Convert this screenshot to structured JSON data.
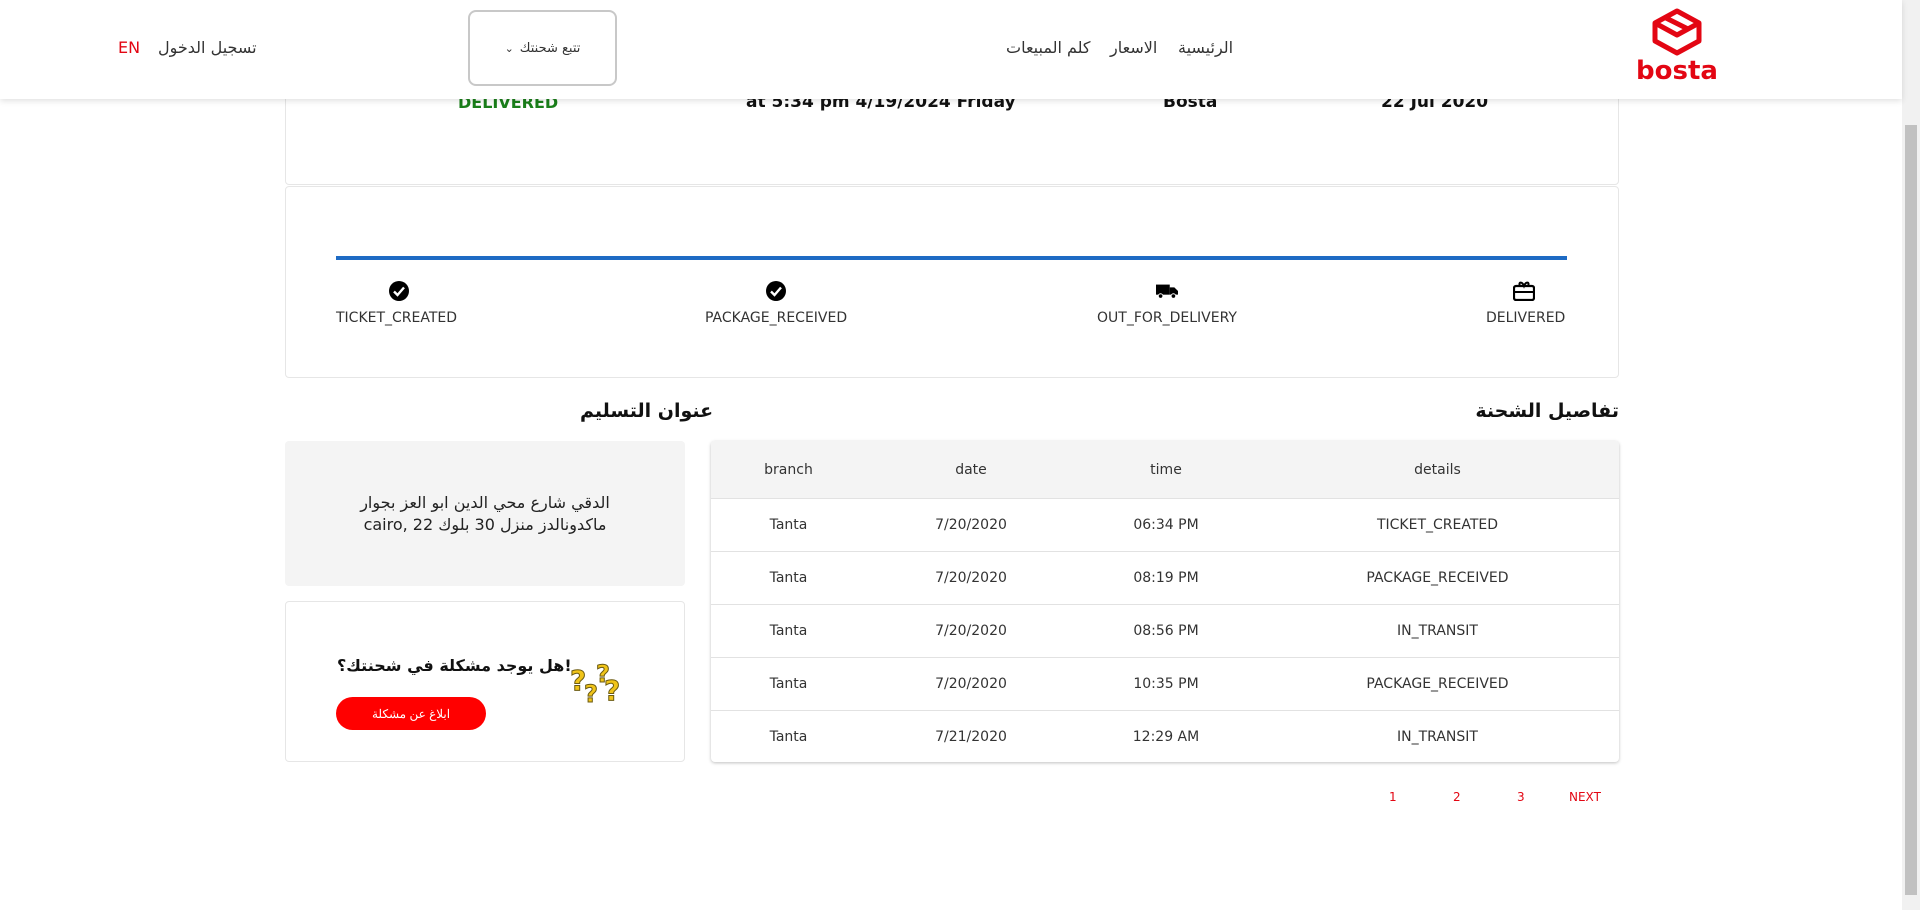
{
  "header": {
    "logo_text": "bosta",
    "nav": {
      "home": "الرئيسية",
      "prices": "الاسعار",
      "sales": "كلم المبيعات"
    },
    "track_label": "تتبع شحنتك",
    "login": "تسجيل الدخول",
    "lang": "EN"
  },
  "summary": {
    "status": "DELIVERED",
    "last_update": "at 5:34 pm 4/19/2024 Friday",
    "merchant": "Bosta",
    "promised_date": "22 Jul 2020"
  },
  "progress": {
    "steps": [
      {
        "label": "TICKET_CREATED",
        "icon": "check-circle-icon"
      },
      {
        "label": "PACKAGE_RECEIVED",
        "icon": "check-circle-icon"
      },
      {
        "label": "OUT_FOR_DELIVERY",
        "icon": "truck-icon"
      },
      {
        "label": "DELIVERED",
        "icon": "gift-box-icon"
      }
    ],
    "accent_color": "#1e6bc4"
  },
  "details": {
    "title": "تفاصيل الشحنة",
    "columns": {
      "branch": "branch",
      "date": "date",
      "time": "time",
      "details": "details"
    },
    "rows": [
      {
        "branch": "Tanta",
        "date": "7/20/2020",
        "time": "06:34 PM",
        "details": "TICKET_CREATED"
      },
      {
        "branch": "Tanta",
        "date": "7/20/2020",
        "time": "08:19 PM",
        "details": "PACKAGE_RECEIVED"
      },
      {
        "branch": "Tanta",
        "date": "7/20/2020",
        "time": "08:56 PM",
        "details": "IN_TRANSIT"
      },
      {
        "branch": "Tanta",
        "date": "7/20/2020",
        "time": "10:35 PM",
        "details": "PACKAGE_RECEIVED"
      },
      {
        "branch": "Tanta",
        "date": "7/21/2020",
        "time": "12:29 AM",
        "details": "IN_TRANSIT"
      }
    ]
  },
  "pagination": {
    "pages": [
      "1",
      "2",
      "3"
    ],
    "next": "NEXT"
  },
  "address": {
    "title": "عنوان التسليم",
    "text": "الدقي شارع محي الدين ابو العز بجوار ماكدونالدز منزل 30 بلوك 22 ,cairo"
  },
  "problem": {
    "title": "هل يوجد مشكلة في شحنتك؟!",
    "button": "ابلاغ عن مشكلة"
  },
  "colors": {
    "brand": "#e30613",
    "delivered": "#1a7f1a",
    "button": "#ff0000"
  }
}
